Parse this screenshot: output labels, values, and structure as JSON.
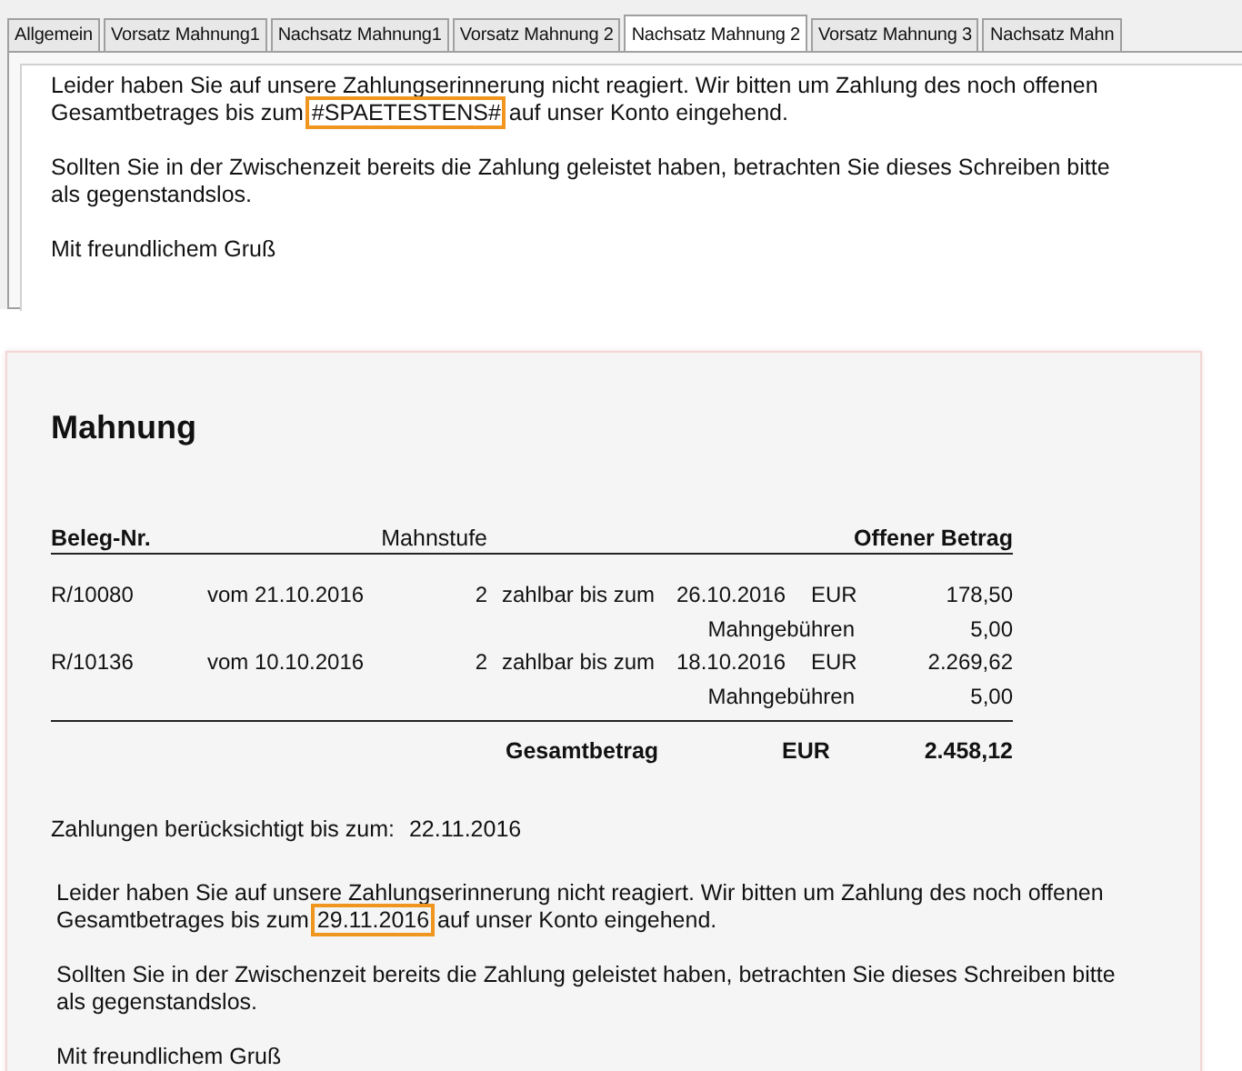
{
  "tabs": [
    {
      "label": "Allgemein",
      "selected": false
    },
    {
      "label": "Vorsatz Mahnung1",
      "selected": false
    },
    {
      "label": "Nachsatz Mahnung1",
      "selected": false
    },
    {
      "label": "Vorsatz Mahnung 2",
      "selected": false
    },
    {
      "label": "Nachsatz Mahnung 2",
      "selected": true
    },
    {
      "label": "Vorsatz Mahnung 3",
      "selected": false
    },
    {
      "label": "Nachsatz Mahn",
      "selected": false
    }
  ],
  "editor": {
    "paragraphs": [
      {
        "lines": [
          [
            {
              "text": "Leider haben Sie auf unsere Zahlungserinnerung nicht reagiert. Wir bitten um Zahlung des noch offenen",
              "highlighted": false
            }
          ],
          [
            {
              "text": "Gesamtbetrages bis zum ",
              "highlighted": false
            },
            {
              "text": "#SPAETESTENS#",
              "highlighted": true
            },
            {
              "text": " auf unser Konto eingehend.",
              "highlighted": false
            }
          ]
        ]
      },
      {
        "lines": [
          [
            {
              "text": "Sollten Sie in der Zwischenzeit bereits die Zahlung geleistet haben, betrachten Sie dieses Schreiben bitte",
              "highlighted": false
            }
          ],
          [
            {
              "text": "als gegenstandslos.",
              "highlighted": false
            }
          ]
        ]
      },
      {
        "lines": [
          [
            {
              "text": "Mit freundlichem Gruß",
              "highlighted": false
            }
          ]
        ]
      }
    ]
  },
  "preview": {
    "title": "Mahnung",
    "columns": {
      "document": "Beleg-Nr.",
      "level": "Mahnstufe",
      "amount": "Offener Betrag"
    },
    "rows": [
      {
        "document": "R/10080",
        "date": "vom 21.10.2016",
        "level": "2",
        "due_label": "zahlbar bis zum",
        "due_date": "26.10.2016",
        "currency": "EUR",
        "amount": "178,50",
        "fee_label": "Mahngebühren",
        "fee": "5,00"
      },
      {
        "document": "R/10136",
        "date": "vom 10.10.2016",
        "level": "2",
        "due_label": "zahlbar bis zum",
        "due_date": "18.10.2016",
        "currency": "EUR",
        "amount": "2.269,62",
        "fee_label": "Mahngebühren",
        "fee": "5,00"
      }
    ],
    "total": {
      "label": "Gesamtbetrag",
      "currency": "EUR",
      "amount": "2.458,12"
    },
    "payments_note": {
      "label": "Zahlungen berücksichtigt bis zum:",
      "date": "22.11.2016"
    },
    "paragraphs": [
      {
        "lines": [
          [
            {
              "text": "Leider haben Sie auf unsere Zahlungserinnerung nicht reagiert. Wir bitten um Zahlung des noch offenen",
              "highlighted": false
            }
          ],
          [
            {
              "text": "Gesamtbetrages bis zum ",
              "highlighted": false
            },
            {
              "text": "29.11.2016",
              "highlighted": true
            },
            {
              "text": " auf unser Konto eingehend.",
              "highlighted": false
            }
          ]
        ]
      },
      {
        "lines": [
          [
            {
              "text": "Sollten Sie in der Zwischenzeit bereits die Zahlung geleistet haben, betrachten Sie dieses Schreiben bitte",
              "highlighted": false
            }
          ],
          [
            {
              "text": "als gegenstandslos.",
              "highlighted": false
            }
          ]
        ]
      },
      {
        "lines": [
          [
            {
              "text": "Mit freundlichem Gruß",
              "highlighted": false
            }
          ]
        ]
      }
    ]
  }
}
